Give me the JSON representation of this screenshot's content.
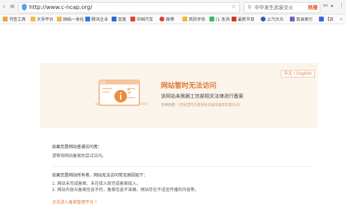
{
  "browser": {
    "url": "http://www.c-ncap.org/",
    "search_text": "中华发生武装交火",
    "search_hot": "热搜",
    "bookmarks": [
      {
        "label": "书签工具",
        "color": "#e5a93b"
      },
      {
        "label": "大导平台",
        "color": "#f1b94a"
      },
      {
        "label": "固始一体化",
        "color": "#f1b94a"
      },
      {
        "label": "腾讯企业",
        "color": "#2f7ae0"
      },
      {
        "label": "百度",
        "color": "#3466d8"
      },
      {
        "label": "中国汽车",
        "color": "#d84a2a"
      },
      {
        "label": "微博",
        "color": "#e33b2e"
      },
      {
        "label": "风险评估",
        "color": "#f0b73f"
      },
      {
        "label": "(1 条消",
        "color": "#3bb86a"
      },
      {
        "label": "最新节目",
        "color": "#d8352a"
      },
      {
        "label": "上汽大众",
        "color": "#2f5fb0"
      },
      {
        "label": "目录索引",
        "color": "#7a5fc0"
      },
      {
        "label": "【百",
        "color": "#3466d8"
      }
    ]
  },
  "notice": {
    "lang_label": "中文丨English",
    "title": "网站暂时无法访问",
    "subtitle": "该网站未根据工信部相关法律进行备案",
    "legal_prefix": "法律依据：",
    "legal_link": "《非经营性互联网信息服务备案管理办法》"
  },
  "visitor": {
    "heading": "如果您是网站普通访问者：",
    "line": "请等待网站备案后尝试访问。"
  },
  "owner": {
    "heading": "如果您是网站所有者，网站无法访问常见原因如下：",
    "reason1": "1. 网站未完成备案，未在接入商完成备案接入。",
    "reason2": "2. 网站内容与备案信息不符，备案信息不准确，网站存在不适宜传播的内容等。",
    "link": "点击进入备案管理平台 〉"
  },
  "colors": {
    "accent": "#e0793b",
    "banner_bg": "#fbf4ea"
  }
}
